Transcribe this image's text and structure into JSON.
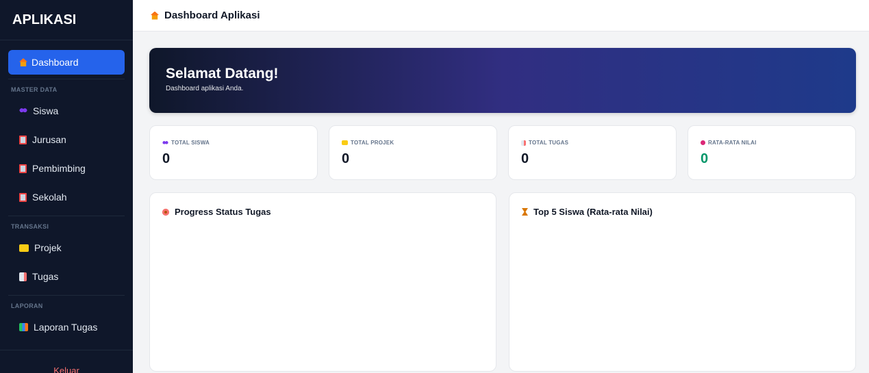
{
  "sidebar": {
    "brand": "APLIKASI",
    "active_item": "Dashboard",
    "sections": {
      "master": "MASTER DATA",
      "transaksi": "TRANSAKSI",
      "laporan": "LAPORAN"
    },
    "items": {
      "siswa": "Siswa",
      "jurusan": "Jurusan",
      "pembimbing": "Pembimbing",
      "sekolah": "Sekolah",
      "projek": "Projek",
      "tugas": "Tugas",
      "laporan_tugas": "Laporan Tugas"
    },
    "logout": "Keluar"
  },
  "topbar": {
    "title": "Dashboard Aplikasi"
  },
  "hero": {
    "title": "Selamat Datang!",
    "subtitle": "Dashboard aplikasi Anda."
  },
  "stats": [
    {
      "label": "TOTAL SISWA",
      "value": "0"
    },
    {
      "label": "TOTAL PROJEK",
      "value": "0"
    },
    {
      "label": "TOTAL TUGAS",
      "value": "0"
    },
    {
      "label": "RATA-RATA NILAI",
      "value": "0"
    }
  ],
  "panels": {
    "progress": "Progress Status Tugas",
    "top5": "Top 5 Siswa (Rata-rata Nilai)"
  },
  "colors": {
    "sidebar_bg": "#0f172a",
    "active": "#2563eb",
    "avg_value": "#059669",
    "logout": "#f87171"
  }
}
